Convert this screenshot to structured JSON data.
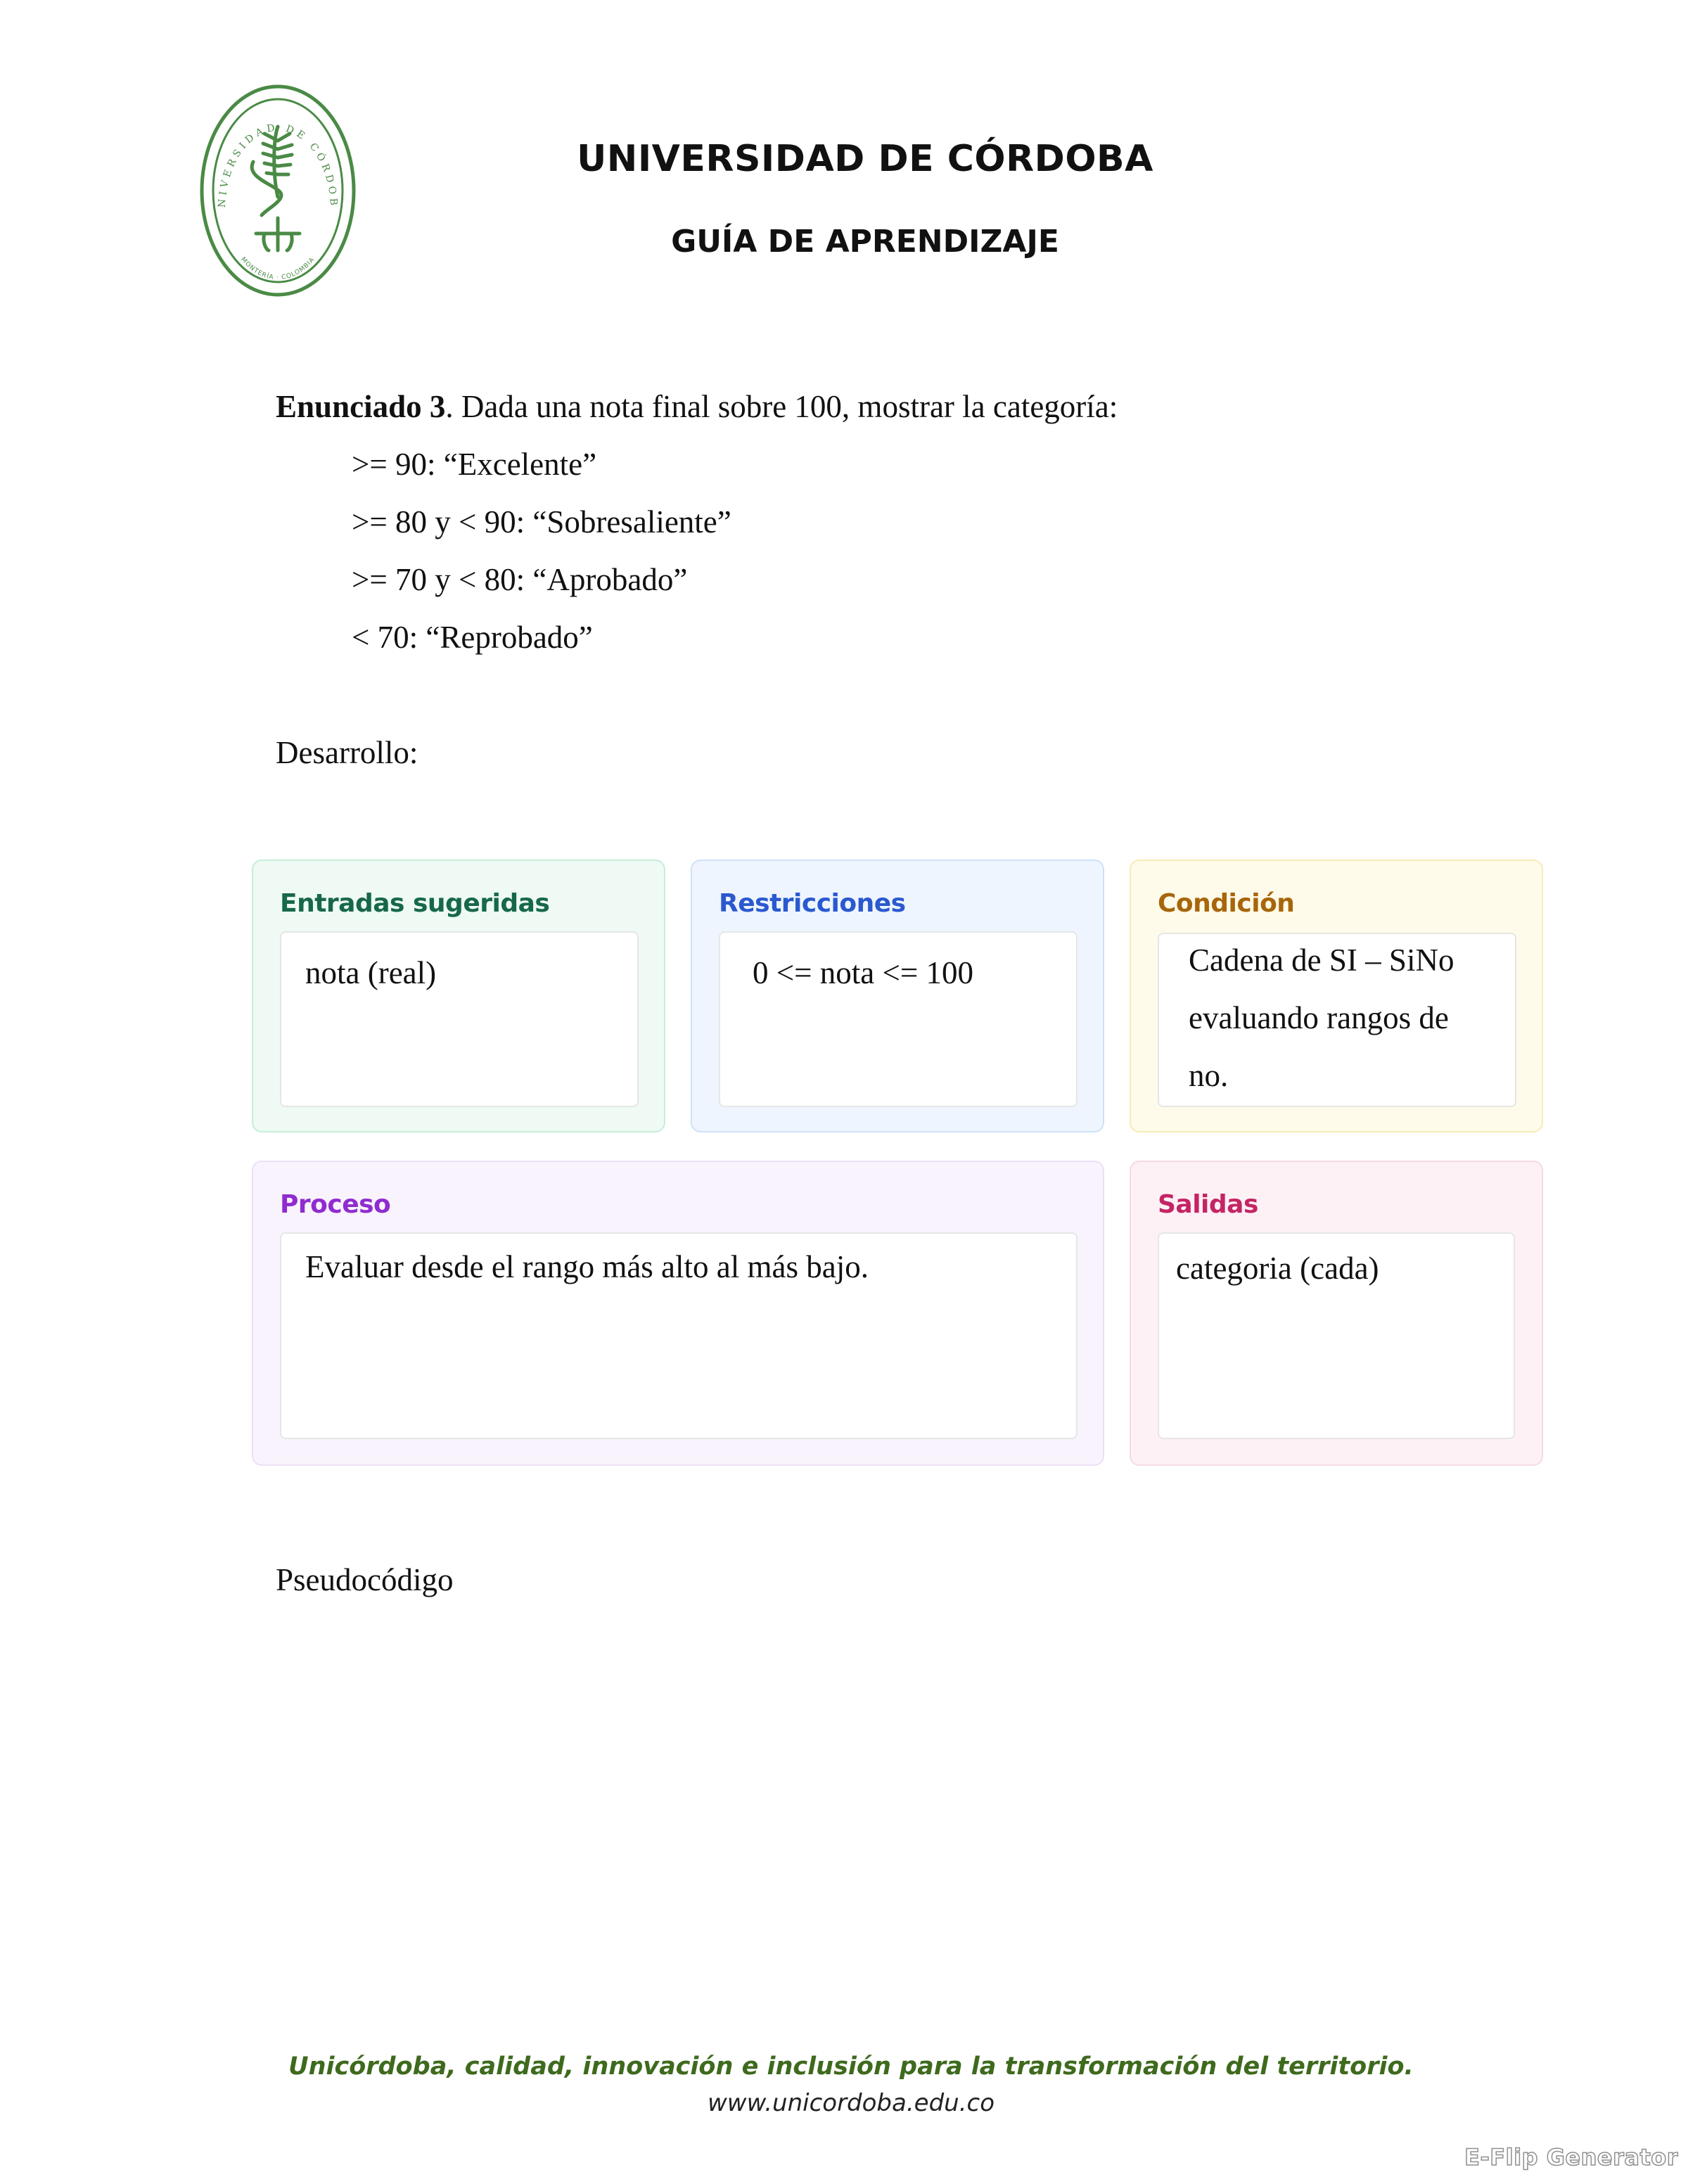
{
  "header": {
    "logo": {
      "ring_text_top": "UNIVERSIDAD DE CÓRDOBA",
      "ring_text_bottom": "MONTERÍA · COLOMBIA",
      "color": "#4a8a45"
    },
    "university_name": "UNIVERSIDAD DE CÓRDOBA",
    "guide_title": "GUÍA DE APRENDIZAJE"
  },
  "statement": {
    "label": "Enunciado 3",
    "text": ". Dada una nota final sobre 100, mostrar la categoría:",
    "categories": [
      ">= 90: “Excelente”",
      ">= 80 y < 90: “Sobresaliente”",
      ">= 70 y < 80: “Aprobado”",
      "< 70: “Reprobado”"
    ]
  },
  "development_label": "Desarrollo:",
  "cards": {
    "inputs": {
      "title": "Entradas sugeridas",
      "content": "nota (real)",
      "color": "#17684a"
    },
    "restrictions": {
      "title": "Restricciones",
      "content": "0 <= nota <= 100",
      "color": "#2a59cf"
    },
    "condition": {
      "title": "Condición",
      "lines": [
        "Cadena de SI – SiNo",
        "evaluando rangos de",
        "no."
      ],
      "color": "#a7660a"
    },
    "process": {
      "title": "Proceso",
      "content": "Evaluar desde el rango más alto al más bajo.",
      "color": "#8f2ccf"
    },
    "outputs": {
      "title": "Salidas",
      "content": "categoria (cada)",
      "color": "#c42465"
    }
  },
  "pseudocode_label": "Pseudocódigo",
  "footer": {
    "slogan": "Unicórdoba, calidad, innovación e inclusión para la transformación del territorio.",
    "url": "www.unicordoba.edu.co"
  },
  "watermark": "E-Flip Generator"
}
